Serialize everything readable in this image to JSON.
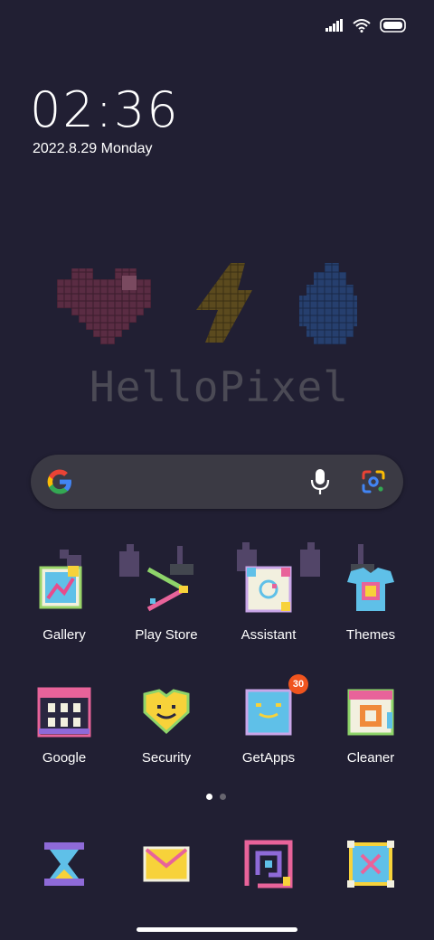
{
  "status_bar": {
    "icons": [
      "signal-icon",
      "wifi-icon",
      "battery-icon"
    ]
  },
  "lock": {
    "time": "02:36",
    "date": "2022.8.29 Monday"
  },
  "widget": {
    "text": "HelloPixel"
  },
  "search_bar": {
    "icons": [
      "google-g-icon",
      "microphone-icon",
      "lens-icon"
    ]
  },
  "apps": [
    {
      "label": "Gallery",
      "icon": "gallery-icon"
    },
    {
      "label": "Play Store",
      "icon": "play-store-icon"
    },
    {
      "label": "Assistant",
      "icon": "assistant-icon"
    },
    {
      "label": "Themes",
      "icon": "themes-icon"
    },
    {
      "label": "Google",
      "icon": "google-folder-icon"
    },
    {
      "label": "Security",
      "icon": "security-icon"
    },
    {
      "label": "GetApps",
      "icon": "getapps-icon",
      "badge": "30"
    },
    {
      "label": "Cleaner",
      "icon": "cleaner-icon"
    }
  ],
  "page_indicator": {
    "pages": 2,
    "current": 1
  },
  "dock": [
    "hourglass-app-icon",
    "mail-app-icon",
    "spiral-app-icon",
    "frame-app-icon"
  ],
  "colors": {
    "background": "#211f33",
    "search_bg": "#3b3a44",
    "badge": "#f0541e"
  }
}
